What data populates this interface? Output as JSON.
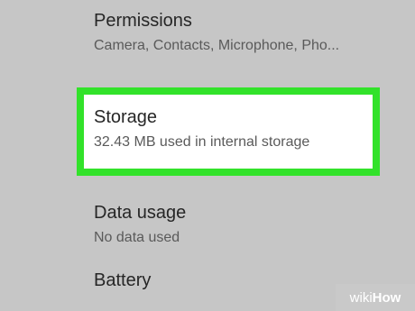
{
  "settings": {
    "items": [
      {
        "title": "Permissions",
        "summary": "Camera, Contacts, Microphone, Pho..."
      },
      {
        "title": "Storage",
        "summary": "32.43 MB used in internal storage"
      },
      {
        "title": "Data usage",
        "summary": "No data used"
      },
      {
        "title": "Battery",
        "summary": ""
      }
    ]
  },
  "highlight": {
    "color": "#32e22a",
    "target": "Storage"
  },
  "watermark": {
    "part1": "wiki",
    "part2": "How"
  }
}
